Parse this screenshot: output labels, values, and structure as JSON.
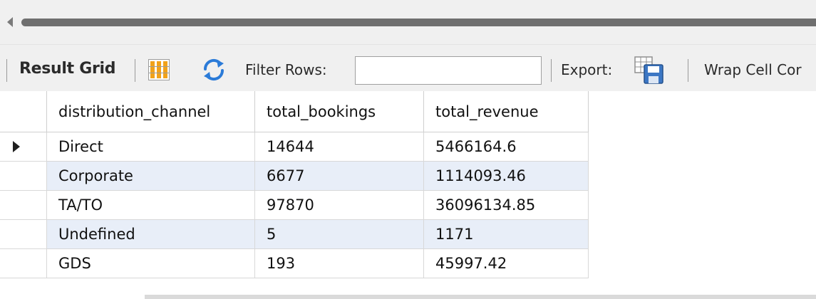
{
  "toolbar": {
    "result_grid_label": "Result Grid",
    "filter_label": "Filter Rows:",
    "filter_value": "",
    "export_label": "Export:",
    "wrap_label": "Wrap Cell Cor"
  },
  "table": {
    "columns": [
      "distribution_channel",
      "total_bookings",
      "total_revenue"
    ],
    "rows": [
      [
        "Direct",
        "14644",
        "5466164.6"
      ],
      [
        "Corporate",
        "6677",
        "1114093.46"
      ],
      [
        "TA/TO",
        "97870",
        "36096134.85"
      ],
      [
        "Undefined",
        "5",
        "1171"
      ],
      [
        "GDS",
        "193",
        "45997.42"
      ]
    ]
  },
  "icons": {
    "scroll_left": "triangle-left-icon",
    "grid_view": "grid-view-icon",
    "refresh": "refresh-icon",
    "export": "export-icon",
    "row_pointer": "row-pointer-icon"
  },
  "colors": {
    "page_background": "#fff7d6",
    "toolbar_background": "#f0f0f0",
    "row_alt": "#e8eef8",
    "grid_icon_accent": "#f1a21a",
    "refresh_accent": "#2b7bd8"
  }
}
